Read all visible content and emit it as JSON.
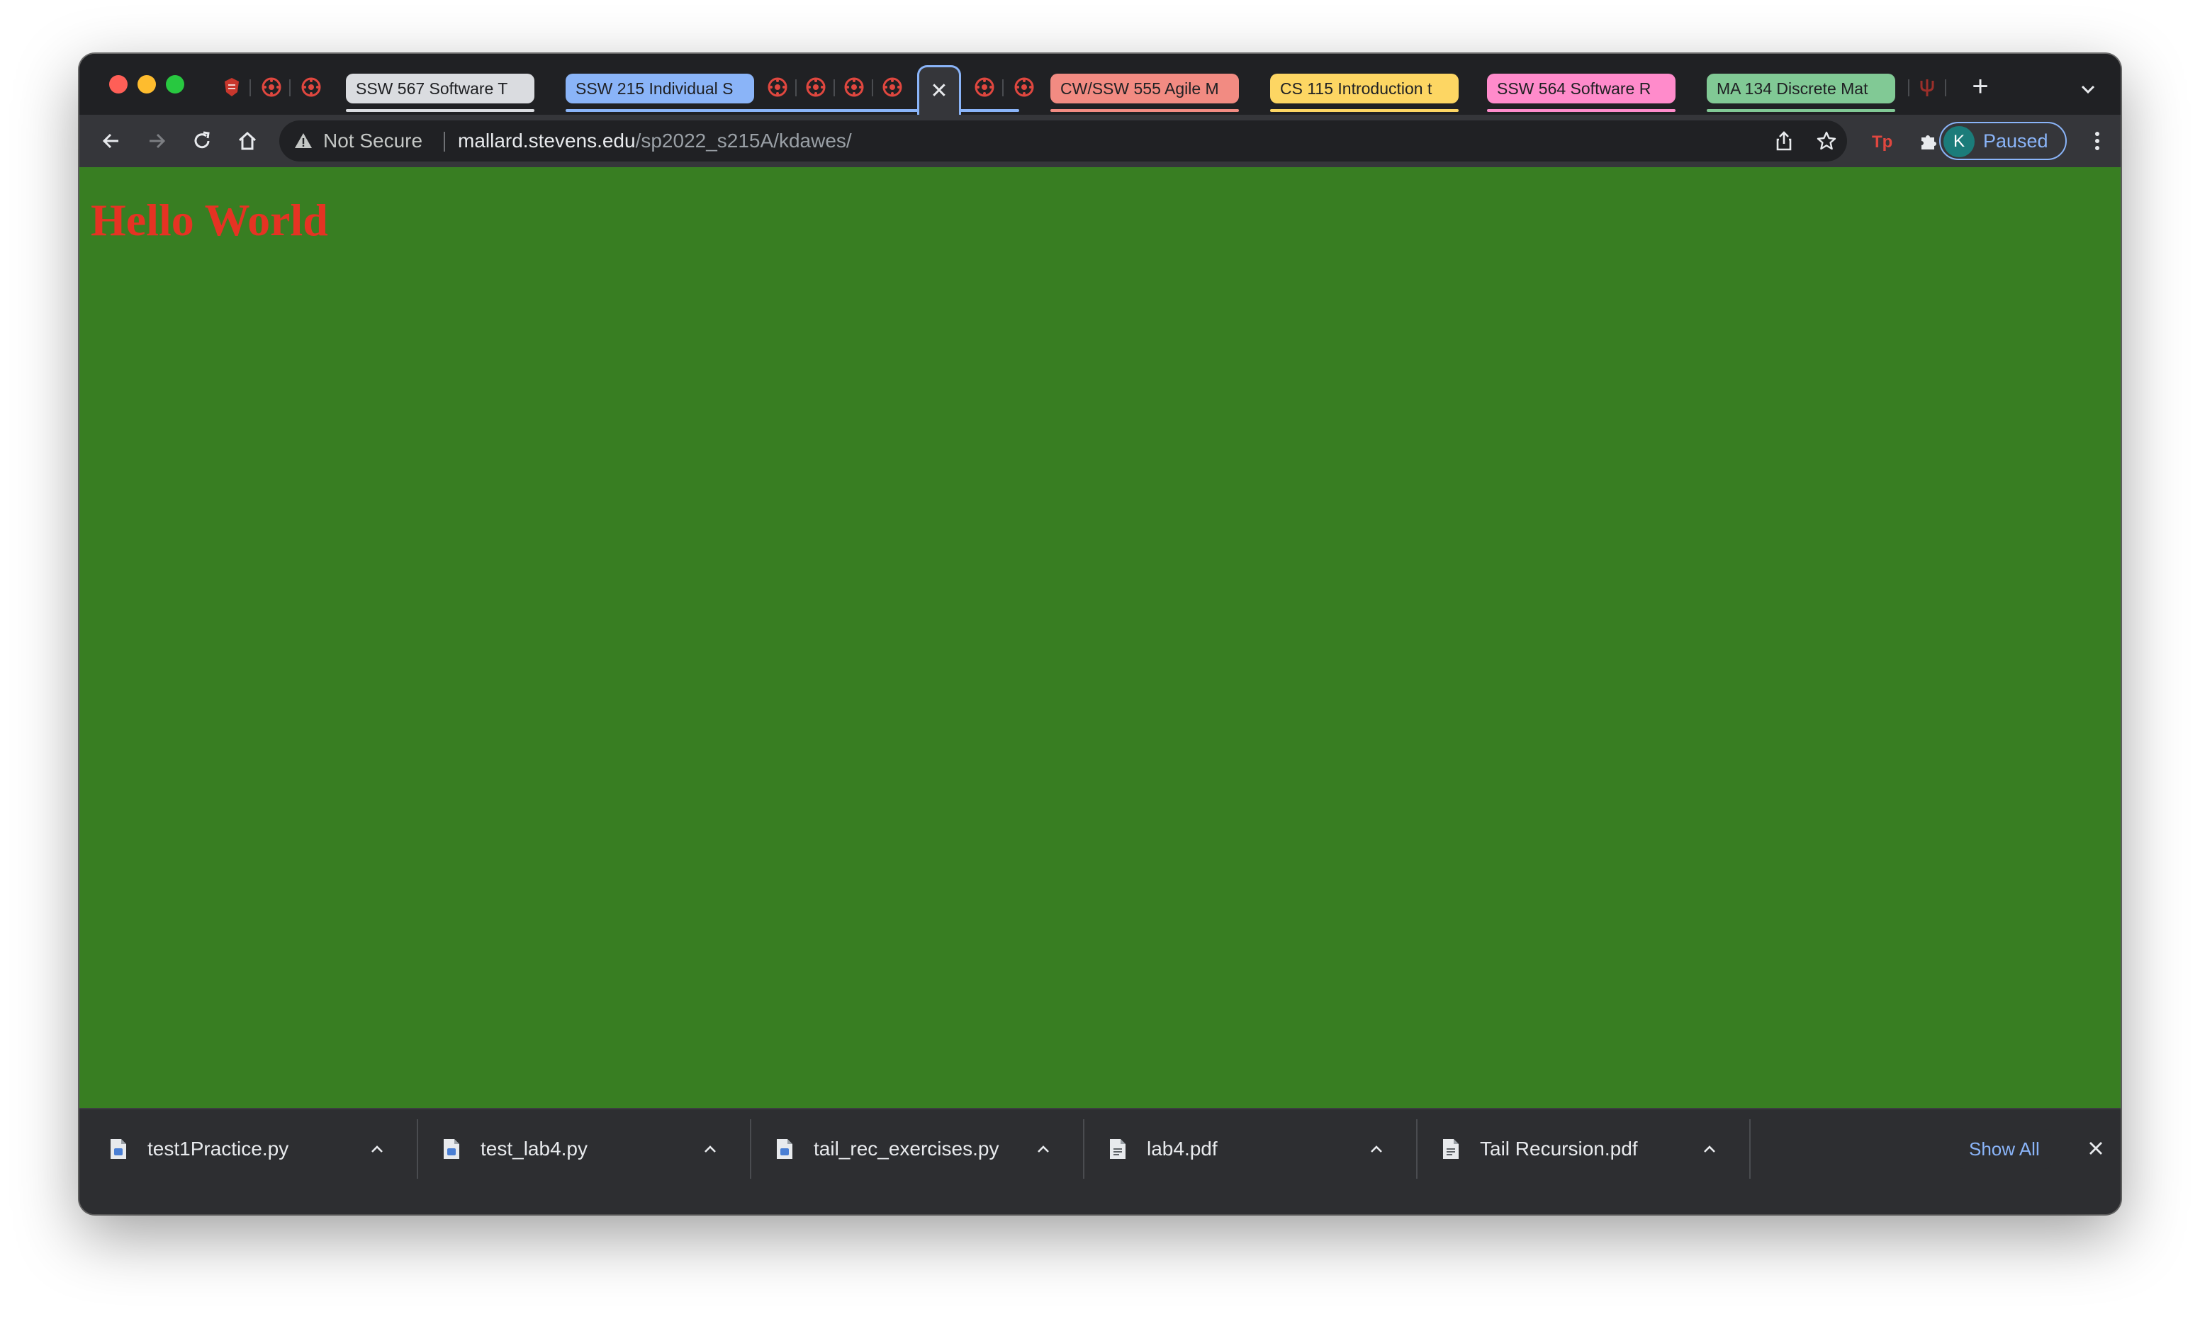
{
  "tab_strip": {
    "groups": [
      {
        "label": "SSW 567 Software T",
        "color": "#dadce0"
      },
      {
        "label": "SSW 215 Individual S",
        "color": "#8ab4f8"
      },
      {
        "label": "CW/SSW 555 Agile M",
        "color": "#f28b82"
      },
      {
        "label": "CS 115 Introduction t",
        "color": "#fdd663"
      },
      {
        "label": "SSW 564 Software R",
        "color": "#ff8bcb"
      },
      {
        "label": "MA 134 Discrete Mat",
        "color": "#81c995"
      }
    ],
    "active_tab_close": "✕",
    "new_tab": "+"
  },
  "toolbar": {
    "security_label": "Not Secure",
    "url_host": "mallard.stevens.edu",
    "url_path": "/sp2022_s215A/kdawes/",
    "profile_initial": "K",
    "profile_status": "Paused"
  },
  "page": {
    "heading": "Hello World",
    "background": "#387e22",
    "heading_color": "#e53323"
  },
  "downloads": {
    "items": [
      {
        "name": "test1Practice.py"
      },
      {
        "name": "test_lab4.py"
      },
      {
        "name": "tail_rec_exercises.py"
      },
      {
        "name": "lab4.pdf"
      },
      {
        "name": "Tail Recursion.pdf"
      }
    ],
    "show_all": "Show All"
  }
}
